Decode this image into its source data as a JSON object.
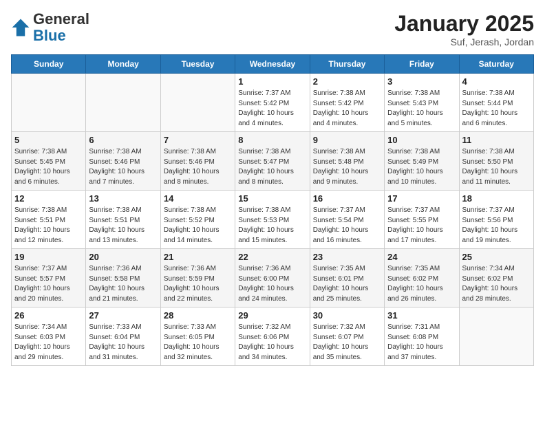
{
  "header": {
    "logo_general": "General",
    "logo_blue": "Blue",
    "month": "January 2025",
    "location": "Suf, Jerash, Jordan"
  },
  "weekdays": [
    "Sunday",
    "Monday",
    "Tuesday",
    "Wednesday",
    "Thursday",
    "Friday",
    "Saturday"
  ],
  "weeks": [
    [
      {
        "day": "",
        "info": ""
      },
      {
        "day": "",
        "info": ""
      },
      {
        "day": "",
        "info": ""
      },
      {
        "day": "1",
        "info": "Sunrise: 7:37 AM\nSunset: 5:42 PM\nDaylight: 10 hours\nand 4 minutes."
      },
      {
        "day": "2",
        "info": "Sunrise: 7:38 AM\nSunset: 5:42 PM\nDaylight: 10 hours\nand 4 minutes."
      },
      {
        "day": "3",
        "info": "Sunrise: 7:38 AM\nSunset: 5:43 PM\nDaylight: 10 hours\nand 5 minutes."
      },
      {
        "day": "4",
        "info": "Sunrise: 7:38 AM\nSunset: 5:44 PM\nDaylight: 10 hours\nand 6 minutes."
      }
    ],
    [
      {
        "day": "5",
        "info": "Sunrise: 7:38 AM\nSunset: 5:45 PM\nDaylight: 10 hours\nand 6 minutes."
      },
      {
        "day": "6",
        "info": "Sunrise: 7:38 AM\nSunset: 5:46 PM\nDaylight: 10 hours\nand 7 minutes."
      },
      {
        "day": "7",
        "info": "Sunrise: 7:38 AM\nSunset: 5:46 PM\nDaylight: 10 hours\nand 8 minutes."
      },
      {
        "day": "8",
        "info": "Sunrise: 7:38 AM\nSunset: 5:47 PM\nDaylight: 10 hours\nand 8 minutes."
      },
      {
        "day": "9",
        "info": "Sunrise: 7:38 AM\nSunset: 5:48 PM\nDaylight: 10 hours\nand 9 minutes."
      },
      {
        "day": "10",
        "info": "Sunrise: 7:38 AM\nSunset: 5:49 PM\nDaylight: 10 hours\nand 10 minutes."
      },
      {
        "day": "11",
        "info": "Sunrise: 7:38 AM\nSunset: 5:50 PM\nDaylight: 10 hours\nand 11 minutes."
      }
    ],
    [
      {
        "day": "12",
        "info": "Sunrise: 7:38 AM\nSunset: 5:51 PM\nDaylight: 10 hours\nand 12 minutes."
      },
      {
        "day": "13",
        "info": "Sunrise: 7:38 AM\nSunset: 5:51 PM\nDaylight: 10 hours\nand 13 minutes."
      },
      {
        "day": "14",
        "info": "Sunrise: 7:38 AM\nSunset: 5:52 PM\nDaylight: 10 hours\nand 14 minutes."
      },
      {
        "day": "15",
        "info": "Sunrise: 7:38 AM\nSunset: 5:53 PM\nDaylight: 10 hours\nand 15 minutes."
      },
      {
        "day": "16",
        "info": "Sunrise: 7:37 AM\nSunset: 5:54 PM\nDaylight: 10 hours\nand 16 minutes."
      },
      {
        "day": "17",
        "info": "Sunrise: 7:37 AM\nSunset: 5:55 PM\nDaylight: 10 hours\nand 17 minutes."
      },
      {
        "day": "18",
        "info": "Sunrise: 7:37 AM\nSunset: 5:56 PM\nDaylight: 10 hours\nand 19 minutes."
      }
    ],
    [
      {
        "day": "19",
        "info": "Sunrise: 7:37 AM\nSunset: 5:57 PM\nDaylight: 10 hours\nand 20 minutes."
      },
      {
        "day": "20",
        "info": "Sunrise: 7:36 AM\nSunset: 5:58 PM\nDaylight: 10 hours\nand 21 minutes."
      },
      {
        "day": "21",
        "info": "Sunrise: 7:36 AM\nSunset: 5:59 PM\nDaylight: 10 hours\nand 22 minutes."
      },
      {
        "day": "22",
        "info": "Sunrise: 7:36 AM\nSunset: 6:00 PM\nDaylight: 10 hours\nand 24 minutes."
      },
      {
        "day": "23",
        "info": "Sunrise: 7:35 AM\nSunset: 6:01 PM\nDaylight: 10 hours\nand 25 minutes."
      },
      {
        "day": "24",
        "info": "Sunrise: 7:35 AM\nSunset: 6:02 PM\nDaylight: 10 hours\nand 26 minutes."
      },
      {
        "day": "25",
        "info": "Sunrise: 7:34 AM\nSunset: 6:02 PM\nDaylight: 10 hours\nand 28 minutes."
      }
    ],
    [
      {
        "day": "26",
        "info": "Sunrise: 7:34 AM\nSunset: 6:03 PM\nDaylight: 10 hours\nand 29 minutes."
      },
      {
        "day": "27",
        "info": "Sunrise: 7:33 AM\nSunset: 6:04 PM\nDaylight: 10 hours\nand 31 minutes."
      },
      {
        "day": "28",
        "info": "Sunrise: 7:33 AM\nSunset: 6:05 PM\nDaylight: 10 hours\nand 32 minutes."
      },
      {
        "day": "29",
        "info": "Sunrise: 7:32 AM\nSunset: 6:06 PM\nDaylight: 10 hours\nand 34 minutes."
      },
      {
        "day": "30",
        "info": "Sunrise: 7:32 AM\nSunset: 6:07 PM\nDaylight: 10 hours\nand 35 minutes."
      },
      {
        "day": "31",
        "info": "Sunrise: 7:31 AM\nSunset: 6:08 PM\nDaylight: 10 hours\nand 37 minutes."
      },
      {
        "day": "",
        "info": ""
      }
    ]
  ]
}
